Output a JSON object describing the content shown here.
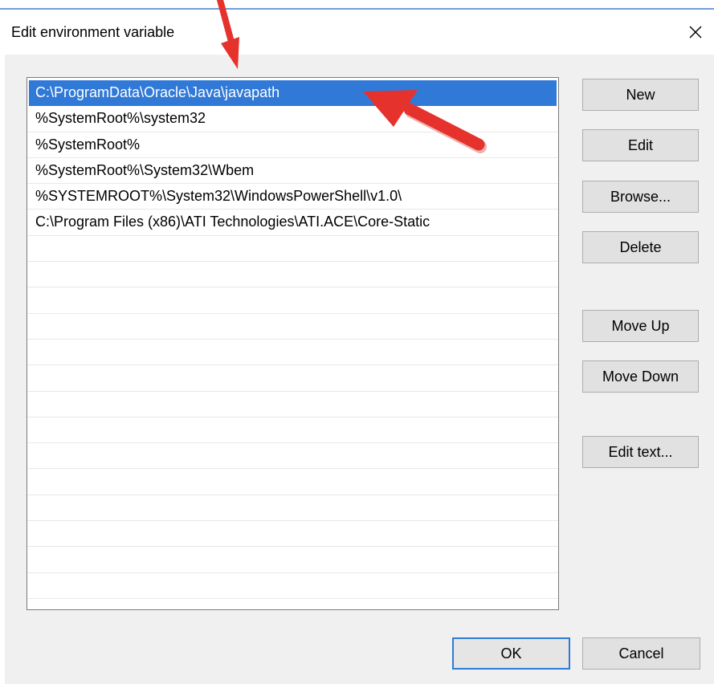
{
  "dialog": {
    "title": "Edit environment variable",
    "close_glyph": "✕"
  },
  "list": {
    "items": [
      {
        "text": "C:\\ProgramData\\Oracle\\Java\\javapath",
        "selected": true
      },
      {
        "text": "%SystemRoot%\\system32",
        "selected": false
      },
      {
        "text": "%SystemRoot%",
        "selected": false
      },
      {
        "text": "%SystemRoot%\\System32\\Wbem",
        "selected": false
      },
      {
        "text": "%SYSTEMROOT%\\System32\\WindowsPowerShell\\v1.0\\",
        "selected": false
      },
      {
        "text": "C:\\Program Files (x86)\\ATI Technologies\\ATI.ACE\\Core-Static",
        "selected": false
      },
      {
        "text": "",
        "selected": false
      },
      {
        "text": "",
        "selected": false
      },
      {
        "text": "",
        "selected": false
      },
      {
        "text": "",
        "selected": false
      },
      {
        "text": "",
        "selected": false
      },
      {
        "text": "",
        "selected": false
      },
      {
        "text": "",
        "selected": false
      },
      {
        "text": "",
        "selected": false
      },
      {
        "text": "",
        "selected": false
      },
      {
        "text": "",
        "selected": false
      },
      {
        "text": "",
        "selected": false
      },
      {
        "text": "",
        "selected": false
      },
      {
        "text": "",
        "selected": false
      },
      {
        "text": "",
        "selected": false
      }
    ]
  },
  "buttons": {
    "new": "New",
    "edit": "Edit",
    "browse": "Browse...",
    "delete": "Delete",
    "move_up": "Move Up",
    "move_down": "Move Down",
    "edit_text": "Edit text...",
    "ok": "OK",
    "cancel": "Cancel"
  },
  "colors": {
    "selection": "#3179d7",
    "annotation_arrow": "#e5322d",
    "focus_border": "#2e7bd6"
  },
  "icons": {
    "close": "close-icon",
    "annotation": "red-arrow-annotation"
  }
}
